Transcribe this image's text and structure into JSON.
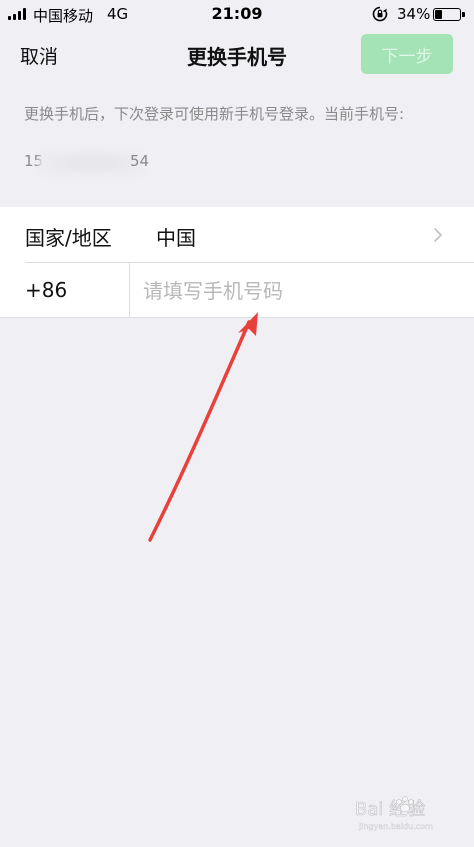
{
  "status_bar": {
    "carrier": "中国移动",
    "network": "4G",
    "time": "21:09",
    "battery_percent": "34%",
    "battery_level": 0.34
  },
  "nav": {
    "cancel_label": "取消",
    "title": "更换手机号",
    "next_label": "下一步",
    "next_color": "#a3e3b5"
  },
  "description": {
    "text": "更换手机后，下次登录可使用新手机号登录。当前手机号:",
    "phone_prefix": "15",
    "phone_suffix": "54"
  },
  "form": {
    "region_label": "国家/地区",
    "region_value": "中国",
    "country_code": "+86",
    "phone_placeholder": "请填写手机号码"
  },
  "annotation": {
    "arrow_color": "#e8413c"
  },
  "watermark": {
    "brand": "Bai 经验",
    "url": "jingyan.baidu.com"
  }
}
